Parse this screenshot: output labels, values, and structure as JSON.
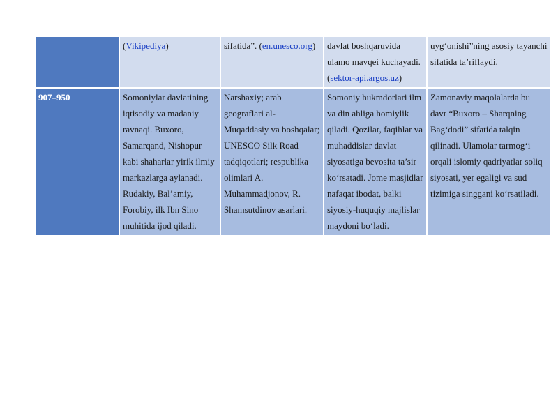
{
  "table": {
    "row_top": {
      "year": "",
      "c2_prefix": "(",
      "c2_link": "Vikipediya",
      "c2_suffix": ")",
      "c3_text": "sifatida”. (",
      "c3_link": "en.unesco.org",
      "c3_suffix": ")",
      "c4_text": "davlat boshqaruvida ulamo mavqei kuchayadi. (",
      "c4_link": "sektor-api.argos.uz",
      "c4_suffix": ")",
      "c5_text": "uyg‘onishi”ning asosiy tayanchi sifatida ta’riflaydi."
    },
    "row_main": {
      "year": "907–950",
      "c2": "Somoniylar davlatining iqtisodiy va madaniy ravnaqi. Buxoro, Samarqand, Nishopur kabi shaharlar yirik ilmiy markazlarga aylanadi. Rudakiy, Bal’amiy, Forobiy, ilk Ibn Sino muhitida ijod qiladi.",
      "c3": "Narshaxiy; arab geograflari al-Muqaddasiy va boshqalar; UNESCO Silk Road tadqiqotlari; respublika olimlari A. Muhammadjonov, R. Shamsutdinov asarlari.",
      "c4": "Somoniy hukmdorlari ilm va din ahliga homiylik qiladi. Qozilar, faqihlar va muhaddislar davlat siyosatiga bevosita ta’sir ko‘rsatadi. Jome masjidlar nafaqat ibodat, balki siyosiy-huquqiy majlislar maydoni bo‘ladi.",
      "c5": "Zamonaviy maqolalarda bu davr “Buxoro – Sharqning Bag‘dodi” sifatida talqin qilinadi. Ulamolar tarmog‘i orqali islomiy qadriyatlar soliq siyosati, yer egaligi va sud tizimiga singgani ko‘rsatiladi."
    }
  }
}
